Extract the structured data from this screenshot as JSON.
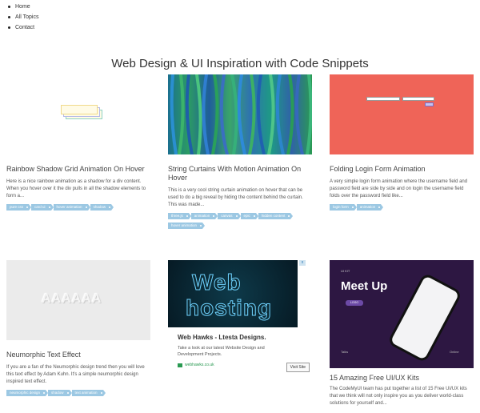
{
  "nav": {
    "items": [
      {
        "label": "Home"
      },
      {
        "label": "All Topics"
      },
      {
        "label": "Contact"
      }
    ]
  },
  "page_title": "Web Design & UI Inspiration with Code Snippets",
  "cards": [
    {
      "title": "Rainbow Shadow Grid Animation On Hover",
      "desc": "Here is a nice rainbow animation as a shadow for a div content. When you hover over it the div pulls in all the shadow elements to form a...",
      "tags": [
        "pure css",
        "card ui",
        "hover animation",
        "shadow"
      ]
    },
    {
      "title": "String Curtains With Motion Animation On Hover",
      "desc": "This is a very cool string curtain animation on hover that can be used to do a big reveal by hiding the content behind the curtain. This was made...",
      "tags": [
        "three.js",
        "animation",
        "canvas",
        "epic",
        "hidden content",
        "hover animation"
      ]
    },
    {
      "title": "Folding Login Form Animation",
      "desc": "A very simple login form animation where the username field and password field are side by side and on login the username field folds over the password field like...",
      "tags": [
        "login form",
        "animation"
      ]
    },
    {
      "title": "Neumorphic Text Effect",
      "desc": "If you are a fan of the Neumorphic design trend then you will love this text effect by Adam Kuhn. It's a simple neumorphic design inspired text effect.",
      "tags": [
        "neumorphic design",
        "shadow",
        "text animation"
      ],
      "thumb_text": "AAAAAA"
    },
    {
      "title": "15 Amazing Free UI/UX Kits",
      "desc": "The CodeMyUI team has put together a list of 15 Free UI/UX kits that we think will not only inspire you as you deliver world-class solutions for yourself and...",
      "thumb": {
        "ui_label": "UI KIT",
        "headline": "Meet Up",
        "badge": "LOGO",
        "left_label": "Talks",
        "right_label": "Online"
      }
    }
  ],
  "ad": {
    "image_text_1": "Web",
    "image_text_2": "hosting",
    "title": "Web Hawks - Ltesta Designs.",
    "desc": "Take a look at our latest Website Design and Development Projects.",
    "url": "webhawks.co.uk",
    "button": "Visit Site",
    "close": "x"
  }
}
